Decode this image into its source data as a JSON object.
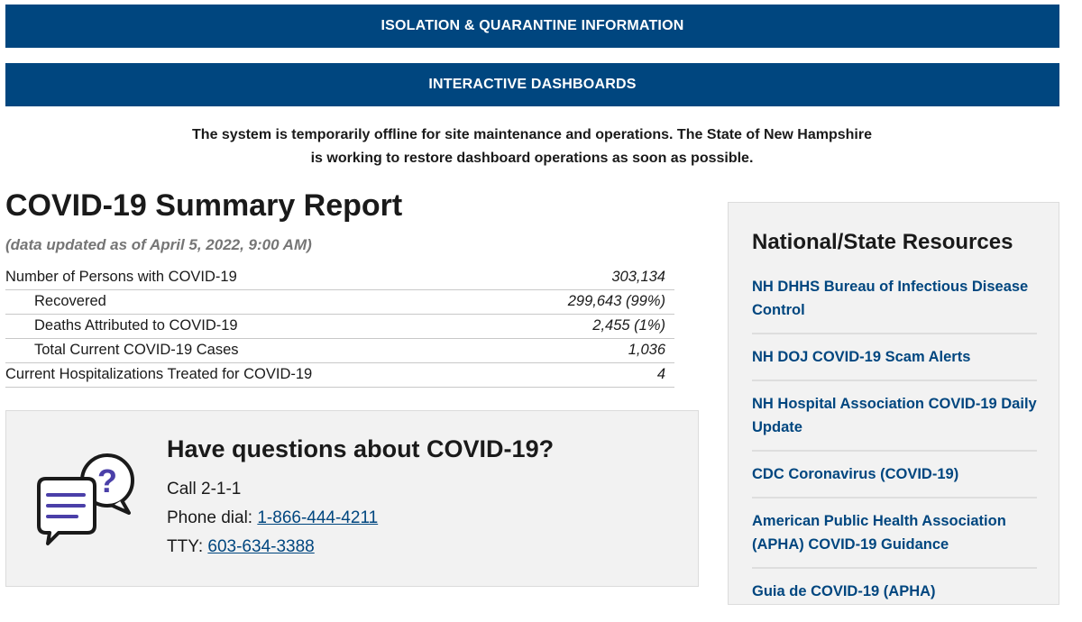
{
  "buttons": {
    "isolation": "ISOLATION & QUARANTINE INFORMATION",
    "dashboards": "INTERACTIVE DASHBOARDS"
  },
  "notice": {
    "line1": "The system is temporarily offline for site maintenance and operations. The State of New Hampshire",
    "line2": "is working to restore dashboard operations as soon as possible."
  },
  "report": {
    "title": "COVID-19 Summary Report",
    "updated": "(data updated as of April 5, 2022, 9:00 AM)",
    "rows": [
      {
        "label": "Number of Persons with COVID-19",
        "value": "303,134"
      },
      {
        "label": "Recovered",
        "value": "299,643 (99%)"
      },
      {
        "label": "Deaths Attributed to COVID-19",
        "value": "2,455 (1%)"
      },
      {
        "label": "Total Current COVID-19 Cases",
        "value": "1,036"
      },
      {
        "label": "Current Hospitalizations Treated for COVID-19",
        "value": "4"
      }
    ]
  },
  "questions": {
    "title": "Have questions about COVID-19?",
    "call": "Call 2-1-1",
    "phone_label": "Phone dial: ",
    "phone_number": "1-866-444-4211",
    "tty_label": "TTY: ",
    "tty_number": "603-634-3388",
    "icon": "chat-question-icon"
  },
  "resources": {
    "title": "National/State Resources",
    "links": [
      "NH DHHS Bureau of Infectious Disease Control",
      "NH DOJ COVID-19 Scam Alerts",
      "NH Hospital Association COVID-19 Daily Update",
      "CDC Coronavirus (COVID-19)",
      "American Public Health Association (APHA) COVID-19 Guidance",
      "Guia de COVID-19 (APHA)"
    ]
  },
  "colors": {
    "brand_blue": "#00467f",
    "panel_gray": "#f2f2f2",
    "icon_purple": "#4a3fa8"
  }
}
